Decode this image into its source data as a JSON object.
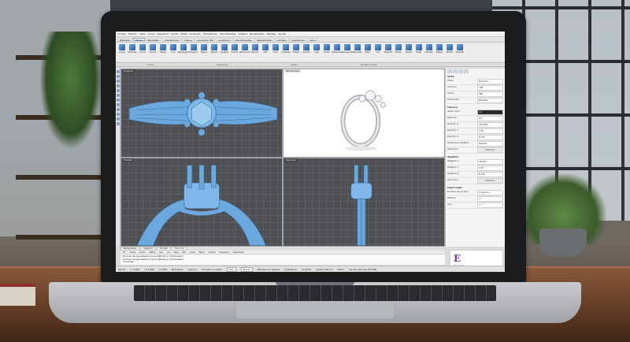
{
  "menu": [
    "Archivo",
    "Edición",
    "Vista",
    "Curva",
    "Superficie",
    "Sólido",
    "Malla",
    "Acotación",
    "Transformar",
    "Herramientas",
    "Análisis",
    "Renderizado",
    "Paneles",
    "Ayuda"
  ],
  "tabs": [
    {
      "label": "Estándar",
      "active": false
    },
    {
      "label": "Plano",
      "active": true
    },
    {
      "label": "Modelado",
      "active": false
    },
    {
      "label": "Transformar",
      "active": false
    },
    {
      "label": "Capas",
      "active": false
    },
    {
      "label": "Impresión 3D",
      "active": false
    },
    {
      "label": "Acotación",
      "active": false
    },
    {
      "label": "Herramientas",
      "active": false
    },
    {
      "label": "Renderizado",
      "active": false
    },
    {
      "label": "Análisis",
      "active": false
    },
    {
      "label": "Animación",
      "active": false
    },
    {
      "label": "Visor",
      "active": false
    }
  ],
  "tools": [
    "Línea",
    "Polilínea",
    "Curva",
    "Círculo",
    "Elipse",
    "Arco",
    "Rectángulo",
    "Polígono",
    "Hélice",
    "Espiral",
    "Desfase",
    "Extruir",
    "Revolución",
    "Barrido",
    "Loft",
    "Red",
    "Cubierta",
    "Esfera",
    "Cilindro",
    "Caja",
    "Unión",
    "Diferencia",
    "Intersección",
    "Recortar",
    "Partir",
    "Unir",
    "Explotar",
    "Mover",
    "Copiar",
    "Rotar",
    "Escalar",
    "Espejo",
    "Matriz",
    "Orientar"
  ],
  "groups": [
    "Curva",
    "Superficie",
    "Sólido",
    "Transformación"
  ],
  "viewports": {
    "top": "Superior",
    "perspective": "Perspectiva",
    "front": "Frontal",
    "right": "Derecha"
  },
  "properties": {
    "section_view": "Vista",
    "view_rows": [
      {
        "k": "Título",
        "v": "Derecha"
      },
      {
        "k": "Anchura",
        "v": "796"
      },
      {
        "k": "Altura",
        "v": "580"
      },
      {
        "k": "Proyección",
        "v": "Paralela"
      }
    ],
    "section_camera": "Cámara",
    "camera_rows": [
      {
        "k": "Lente (mm)",
        "v": "50",
        "dark": true
      },
      {
        "k": "Rotación",
        "v": "0.0"
      },
      {
        "k": "Posición X",
        "v": "130.652"
      },
      {
        "k": "Posición Y",
        "v": "1.87"
      },
      {
        "k": "Posición Z",
        "v": "8.731"
      },
      {
        "k": "Distancia a objetivo",
        "v": "80.029"
      },
      {
        "k": "Ubicación",
        "v": "Colocar...",
        "btn": true
      }
    ],
    "section_target": "Objetivo",
    "target_rows": [
      {
        "k": "Objetivo X",
        "v": "26.433"
      },
      {
        "k": "Objetivo Y",
        "v": "1.87"
      },
      {
        "k": "Objetivo Z",
        "v": "8.731"
      },
      {
        "k": "Ubicación",
        "v": "Colocar...",
        "btn": true
      }
    ],
    "section_wallpaper": "Papel tapiz",
    "wallpaper_rows": [
      {
        "k": "Nombre de archivo",
        "v": "(ninguno)"
      },
      {
        "k": "Mostrar",
        "v": "☐"
      },
      {
        "k": "Gris",
        "v": "☐"
      }
    ]
  },
  "logo": {
    "mark": "E",
    "name": "Elementia",
    "caption": "Downloaded Elementi"
  },
  "view_tabs": [
    {
      "label": "Perspectiva",
      "active": false
    },
    {
      "label": "Superior",
      "active": false
    },
    {
      "label": "Frontal",
      "active": false
    },
    {
      "label": "Derecha",
      "active": true
    }
  ],
  "snaps": [
    "Fin",
    "Cerca",
    "Punto",
    "Medio",
    "Cen",
    "Int",
    "Perp",
    "Tan",
    "Cuad",
    "Nudo",
    "Vértice",
    "Proyectar",
    "Desactivar"
  ],
  "command_lines": [
    "El modo de visualización se ha definido a \"Sombreado\".",
    "El modo de visualización se ha definido a \"Sombreado\".",
    "Comando:"
  ],
  "status": {
    "plane": "PlanoC",
    "x": "x -1.000",
    "y": "y 11.864",
    "z": "z 0.000",
    "units": "Milímetros",
    "layer": "Capa 01",
    "items": [
      "Forzado a la rejilla",
      "Orto",
      "Planar",
      "Referencia a objetos",
      "SmartTrack",
      "Gumball",
      "Grabar historial",
      "Filtrar",
      "Uso de memoria: 853 MB"
    ],
    "active_items": [
      "Orto",
      "Planar"
    ]
  },
  "colors": {
    "model_blue": "#6aa8de",
    "viewport_bg": "#4d4f52",
    "accent_purple": "#7b3aa0"
  }
}
